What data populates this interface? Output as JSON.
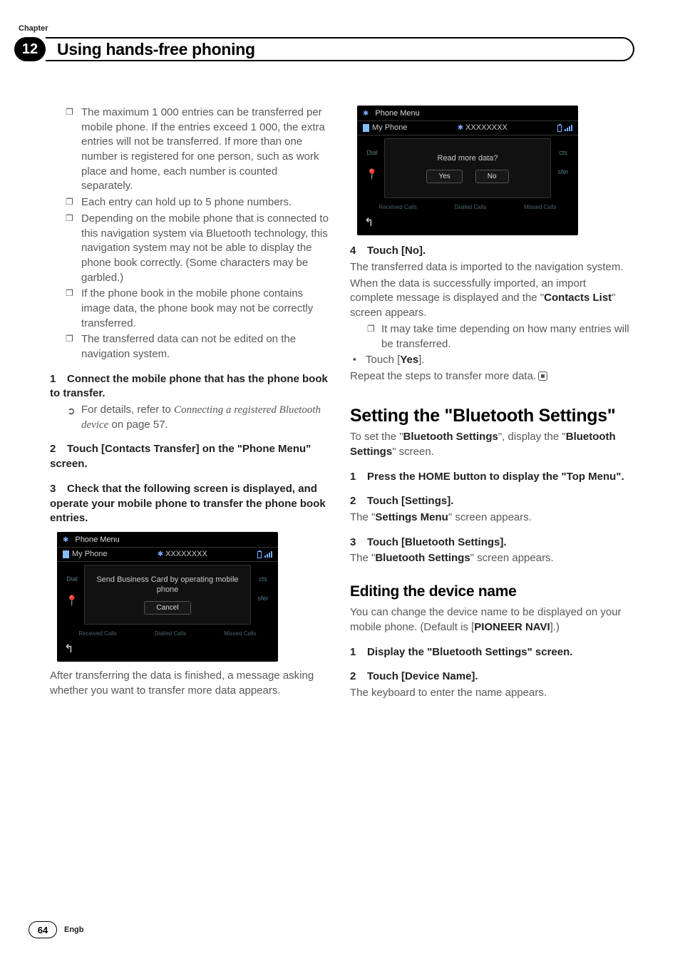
{
  "chapter_label": "Chapter",
  "chapter_number": "12",
  "chapter_title": "Using hands-free phoning",
  "left": {
    "bullets": [
      "The maximum 1 000 entries can be transferred per mobile phone. If the entries exceed 1 000, the extra entries will not be transferred. If more than one number is registered for one person, such as work place and home, each number is counted separately.",
      "Each entry can hold up to 5 phone numbers.",
      "Depending on the mobile phone that is connected to this navigation system via Bluetooth technology, this navigation system may not be able to display the phone book correctly. (Some characters may be garbled.)",
      "If the phone book in the mobile phone contains image data, the phone book may not be correctly transferred.",
      "The transferred data can not be edited on the navigation system."
    ],
    "step1_num": "1",
    "step1_head": "Connect the mobile phone that has the phone book to transfer.",
    "step1_ref_prefix": "For details, refer to ",
    "step1_ref_italic": "Connecting a registered Bluetooth device",
    "step1_ref_suffix": " on page 57.",
    "step2_num": "2",
    "step2_head": "Touch [Contacts Transfer] on the \"Phone Menu\" screen.",
    "step3_num": "3",
    "step3_head": "Check that the following screen is displayed, and operate your mobile phone to transfer the phone book entries.",
    "after_text": "After transferring the data is finished, a message asking whether you want to transfer more data appears."
  },
  "screenshot1": {
    "top_label": "Phone Menu",
    "row2_label": "My Phone",
    "row2_id": "XXXXXXXX",
    "side_left": "Dial",
    "side_right_1": "cts",
    "side_right_2": "sfer",
    "msg_line1": "Send Business Card by operating mobile",
    "msg_line2": "phone",
    "btn_cancel": "Cancel",
    "tab1": "Received Calls",
    "tab2": "Dialled Calls",
    "tab3": "Missed Calls",
    "back": "↰"
  },
  "screenshot2": {
    "top_label": "Phone Menu",
    "row2_label": "My Phone",
    "row2_id": "XXXXXXXX",
    "side_left": "Dial",
    "side_right_1": "cts",
    "side_right_2": "sfer",
    "msg": "Read more data?",
    "btn_yes": "Yes",
    "btn_no": "No",
    "tab1": "Received Calls",
    "tab2": "Dialled Calls",
    "tab3": "Missed Calls",
    "back": "↰"
  },
  "right": {
    "step4_num": "4",
    "step4_head": "Touch [No].",
    "step4_p1": "The transferred data is imported to the navigation system.",
    "step4_p2_a": "When the data is successfully imported, an import complete message is displayed and the \"",
    "step4_p2_bold": "Contacts List",
    "step4_p2_b": "\" screen appears.",
    "step4_note": "It may take time depending on how many entries will be transferred.",
    "step4_sq_a": "Touch [",
    "step4_sq_bold": "Yes",
    "step4_sq_b": "].",
    "step4_repeat": "Repeat the steps to transfer more data.",
    "heading2_a": "Setting the \"",
    "heading2_b": "Bluetooth Settings",
    "heading2_c": "\"",
    "sec2_p_a": "To set the \"",
    "sec2_p_b1": "Bluetooth Settings",
    "sec2_p_c": "\", display the \"",
    "sec2_p_b2": "Bluetooth Settings",
    "sec2_p_d": "\" screen.",
    "sec2_s1_num": "1",
    "sec2_s1_head": "Press the HOME button to display the \"Top Menu\".",
    "sec2_s2_num": "2",
    "sec2_s2_head": "Touch [Settings].",
    "sec2_s2_p_a": "The \"",
    "sec2_s2_p_b": "Settings Menu",
    "sec2_s2_p_c": "\" screen appears.",
    "sec2_s3_num": "3",
    "sec2_s3_head": "Touch [Bluetooth Settings].",
    "sec2_s3_p_a": "The \"",
    "sec2_s3_p_b": "Bluetooth Settings",
    "sec2_s3_p_c": "\" screen appears.",
    "heading3": "Editing the device name",
    "sec3_p_a": "You can change the device name to be displayed on your mobile phone. (Default is [",
    "sec3_p_bold": "PIONEER NAVI",
    "sec3_p_b": "].)",
    "sec3_s1_num": "1",
    "sec3_s1_head": "Display the \"Bluetooth Settings\" screen.",
    "sec3_s2_num": "2",
    "sec3_s2_head": "Touch [Device Name].",
    "sec3_s2_p": "The keyboard to enter the name appears."
  },
  "footer": {
    "page": "64",
    "lang": "Engb"
  }
}
